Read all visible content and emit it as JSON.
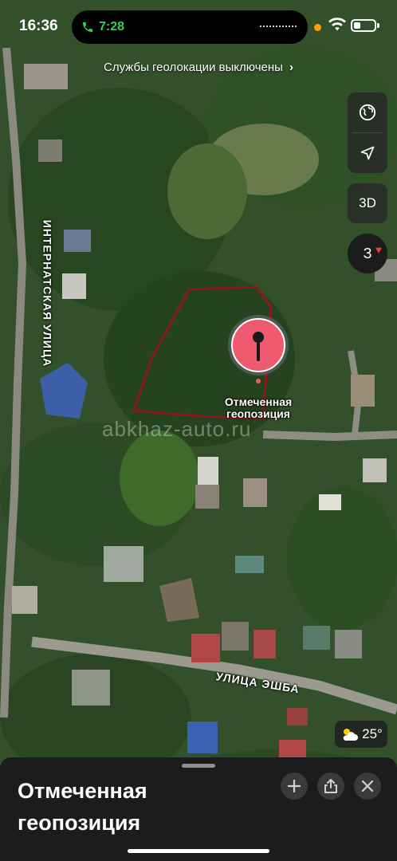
{
  "status_bar": {
    "time": "16:36",
    "call_timer": "7:28",
    "battery_level": 0.35
  },
  "banner": {
    "text": "Службы геолокации выключены",
    "chevron": "chevron-right-icon"
  },
  "controls": {
    "map_mode_icon": "globe-icon",
    "location_icon": "location-arrow-icon",
    "view_3d_label": "3D",
    "compass_label": "З"
  },
  "map": {
    "street_labels": [
      "ИНТЕРНАТСКАЯ УЛИЦА",
      "УЛИЦА ЭШБА"
    ],
    "pin_label": "Отмеченная геопозиция",
    "watermark": "abkhaz-auto.ru"
  },
  "weather": {
    "icon": "partly-cloudy-icon",
    "temperature": "25°"
  },
  "sheet": {
    "title": "Отмеченная геопозиция",
    "buttons": [
      "plus-icon",
      "share-icon",
      "close-icon"
    ]
  },
  "colors": {
    "pin": "#f05a6e",
    "boundary": "#8b1a1a",
    "call_green": "#30d158",
    "indicator_orange": "#ff9f0a"
  }
}
